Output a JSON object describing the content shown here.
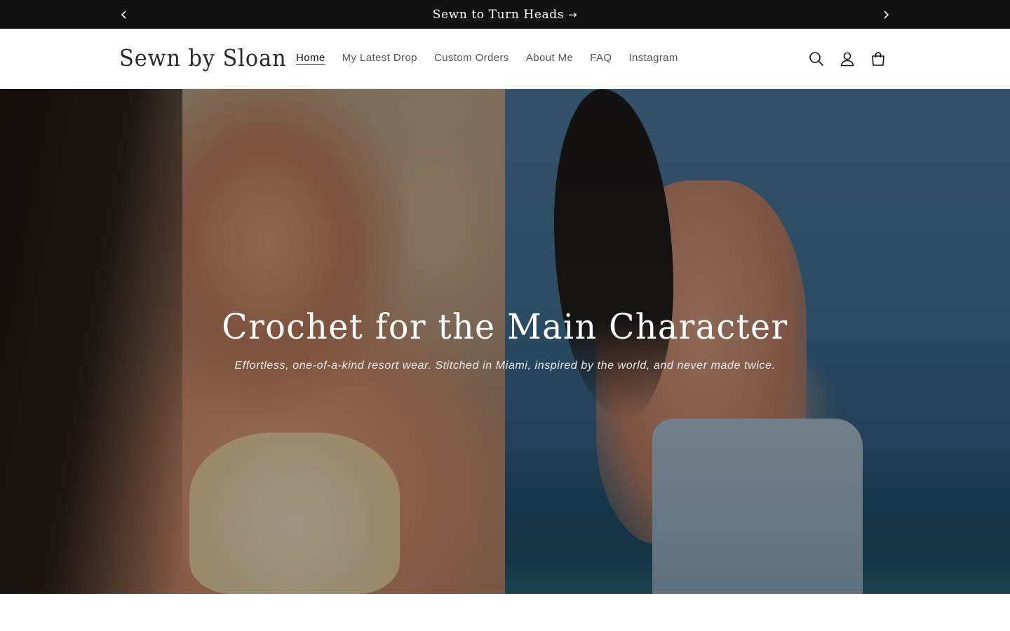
{
  "announcement": {
    "text": "Sewn to Turn Heads",
    "arrow": "→",
    "prev_icon": "chevron-left-icon",
    "next_icon": "chevron-right-icon"
  },
  "header": {
    "logo": "Sewn by Sloan",
    "nav": [
      {
        "label": "Home",
        "active": true
      },
      {
        "label": "My Latest Drop",
        "active": false
      },
      {
        "label": "Custom Orders",
        "active": false
      },
      {
        "label": "About Me",
        "active": false
      },
      {
        "label": "FAQ",
        "active": false
      },
      {
        "label": "Instagram",
        "active": false
      }
    ],
    "icons": [
      "search-icon",
      "account-icon",
      "cart-icon"
    ]
  },
  "hero": {
    "title": "Crochet for the Main Character",
    "subtitle": "Effortless, one-of-a-kind resort wear. Stitched in Miami, inspired by the world, and never made twice."
  },
  "colors": {
    "announcement_bg": "#121212",
    "announcement_text": "#ffffff",
    "nav_text": "#555555",
    "nav_active": "#121212",
    "hero_text": "#ffffff"
  }
}
